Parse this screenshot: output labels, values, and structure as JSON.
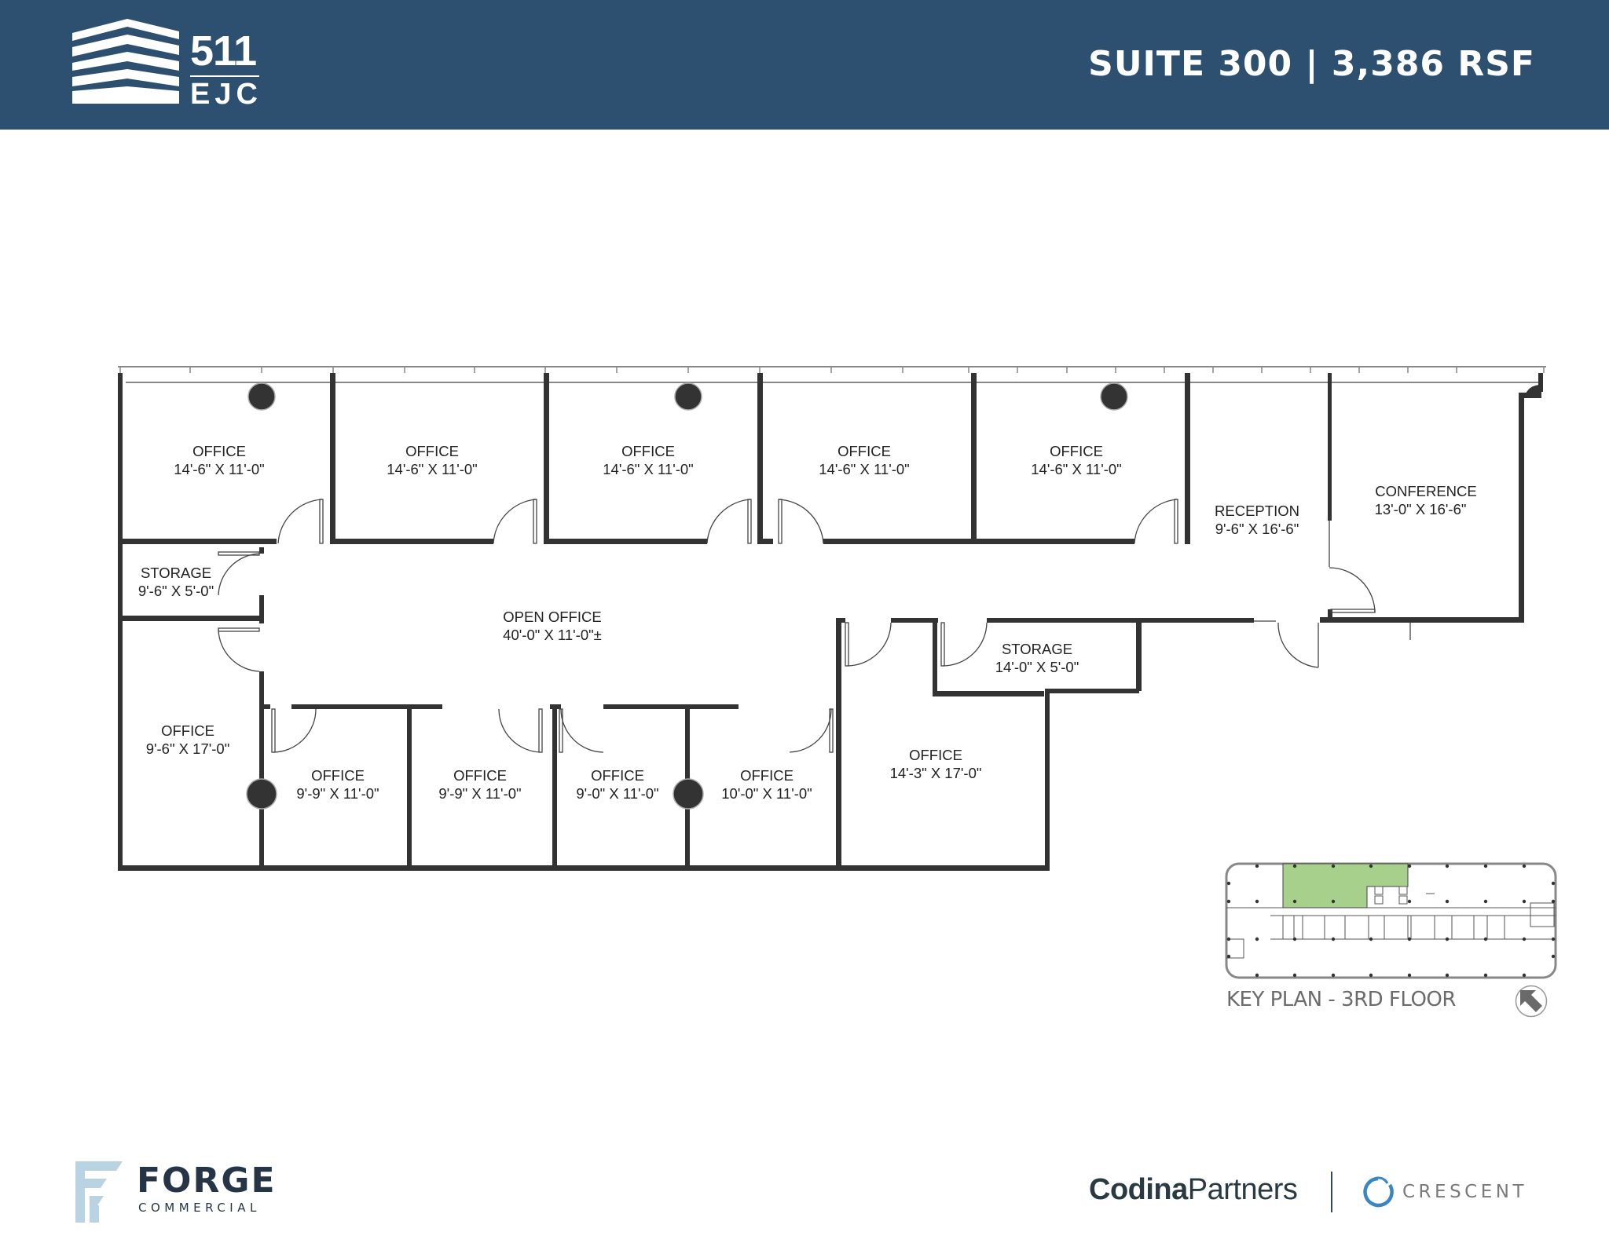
{
  "header": {
    "logo_number": "511",
    "logo_letters": "EJC",
    "suite_title": "SUITE 300 | 3,386 RSF",
    "background_color": "#2d5070"
  },
  "floor_plan": {
    "rooms": [
      {
        "name": "OFFICE",
        "size": "14'-6\" X 11'-0\""
      },
      {
        "name": "OFFICE",
        "size": "14'-6\" X 11'-0\""
      },
      {
        "name": "OFFICE",
        "size": "14'-6\" X 11'-0\""
      },
      {
        "name": "OFFICE",
        "size": "14'-6\" X 11'-0\""
      },
      {
        "name": "OFFICE",
        "size": "14'-6\" X 11'-0\""
      },
      {
        "name": "RECEPTION",
        "size": "9'-6\" X 16'-6\""
      },
      {
        "name": "CONFERENCE",
        "size": "13'-0\" X 16'-6\""
      },
      {
        "name": "STORAGE",
        "size": "9'-6\" X 5'-0\""
      },
      {
        "name": "OPEN OFFICE",
        "size": "40'-0\" X 11'-0\"±"
      },
      {
        "name": "STORAGE",
        "size": "14'-0\" X 5'-0\""
      },
      {
        "name": "OFFICE",
        "size": "9'-6\" X 17'-0\""
      },
      {
        "name": "OFFICE",
        "size": "9'-9\" X 11'-0\""
      },
      {
        "name": "OFFICE",
        "size": "9'-9\" X 11'-0\""
      },
      {
        "name": "OFFICE",
        "size": "9'-0\" X 11'-0\""
      },
      {
        "name": "OFFICE",
        "size": "10'-0\" X 11'-0\""
      },
      {
        "name": "OFFICE",
        "size": "14'-3\" X 17'-0\""
      }
    ]
  },
  "key_plan": {
    "caption": "KEY PLAN - 3RD FLOOR",
    "highlight_color": "#a8d08d",
    "north_icon": "north-arrow-icon"
  },
  "footer": {
    "forge_name": "FORGE",
    "forge_sub": "COMMERCIAL",
    "codina_bold": "Codina",
    "codina_light": "Partners",
    "crescent": "CRESCENT",
    "crescent_color": "#3a86c4"
  }
}
